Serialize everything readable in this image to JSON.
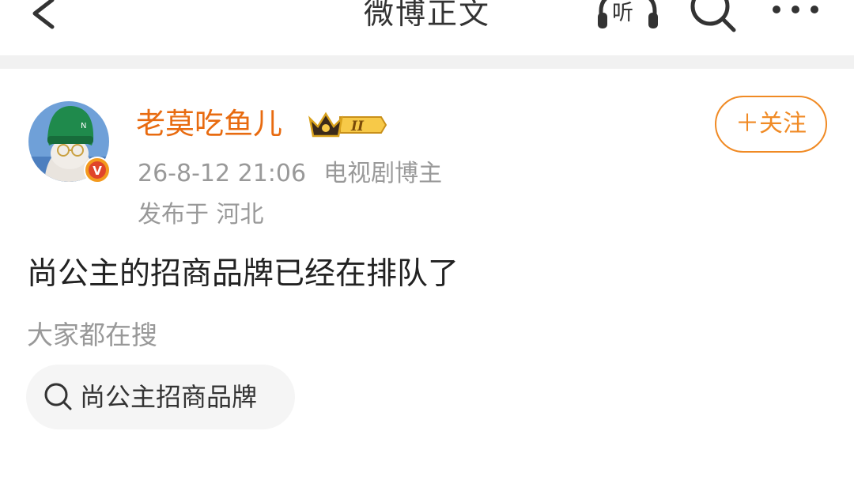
{
  "header": {
    "title": "微博正文",
    "listen_label": "听"
  },
  "post": {
    "author": {
      "name": "老莫吃鱼儿",
      "verified_badge": "V",
      "vip_badge": "II"
    },
    "timestamp": "26-8-12 21:06",
    "role": "电视剧博主",
    "location": "发布于 河北",
    "follow_label": "＋关注",
    "content": "尚公主的招商品牌已经在排队了"
  },
  "trending": {
    "label": "大家都在搜",
    "chips": [
      {
        "text": "尚公主招商品牌"
      }
    ]
  },
  "colors": {
    "accent": "#f08a24",
    "username": "#e86b10",
    "verified": "#f39a1e",
    "muted_text": "#999999",
    "body_text": "#222222"
  },
  "icons": {
    "back": "chevron-left-icon",
    "listen": "headphones-icon",
    "search": "search-icon",
    "more": "more-dots-icon",
    "verified": "verified-v-icon",
    "crown": "crown-icon",
    "chip_search": "search-icon"
  }
}
